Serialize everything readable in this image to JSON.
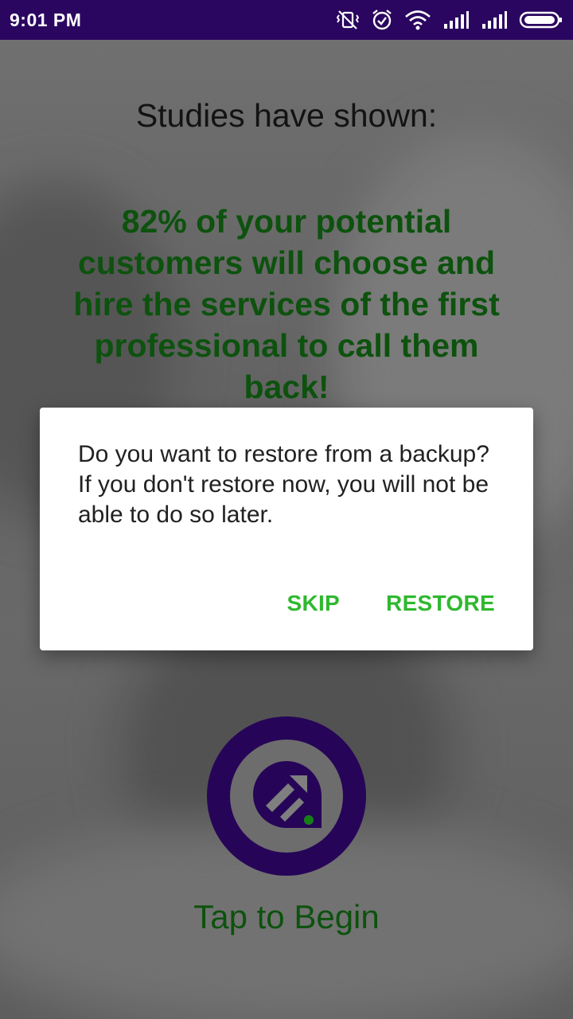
{
  "status_bar": {
    "time": "9:01 PM",
    "icons": [
      "vibrate-off-icon",
      "alarm-icon",
      "wifi-icon",
      "signal-icon",
      "signal-icon",
      "battery-icon"
    ]
  },
  "main": {
    "headline": "Studies have shown:",
    "stat_text": "82% of your potential customers will choose and hire the services of the first professional to call them back!",
    "tap_label": "Tap to Begin",
    "logo_icon": "edit-bubble-icon"
  },
  "dialog": {
    "message_line1": "Do you want to restore from a backup?",
    "message_line2": "If you don't restore now, you will not be able to do so later.",
    "skip_label": "SKIP",
    "restore_label": "RESTORE"
  },
  "colors": {
    "brand_purple": "#2a0660",
    "headline_green": "#0f5a10",
    "button_green": "#2fb82f"
  }
}
